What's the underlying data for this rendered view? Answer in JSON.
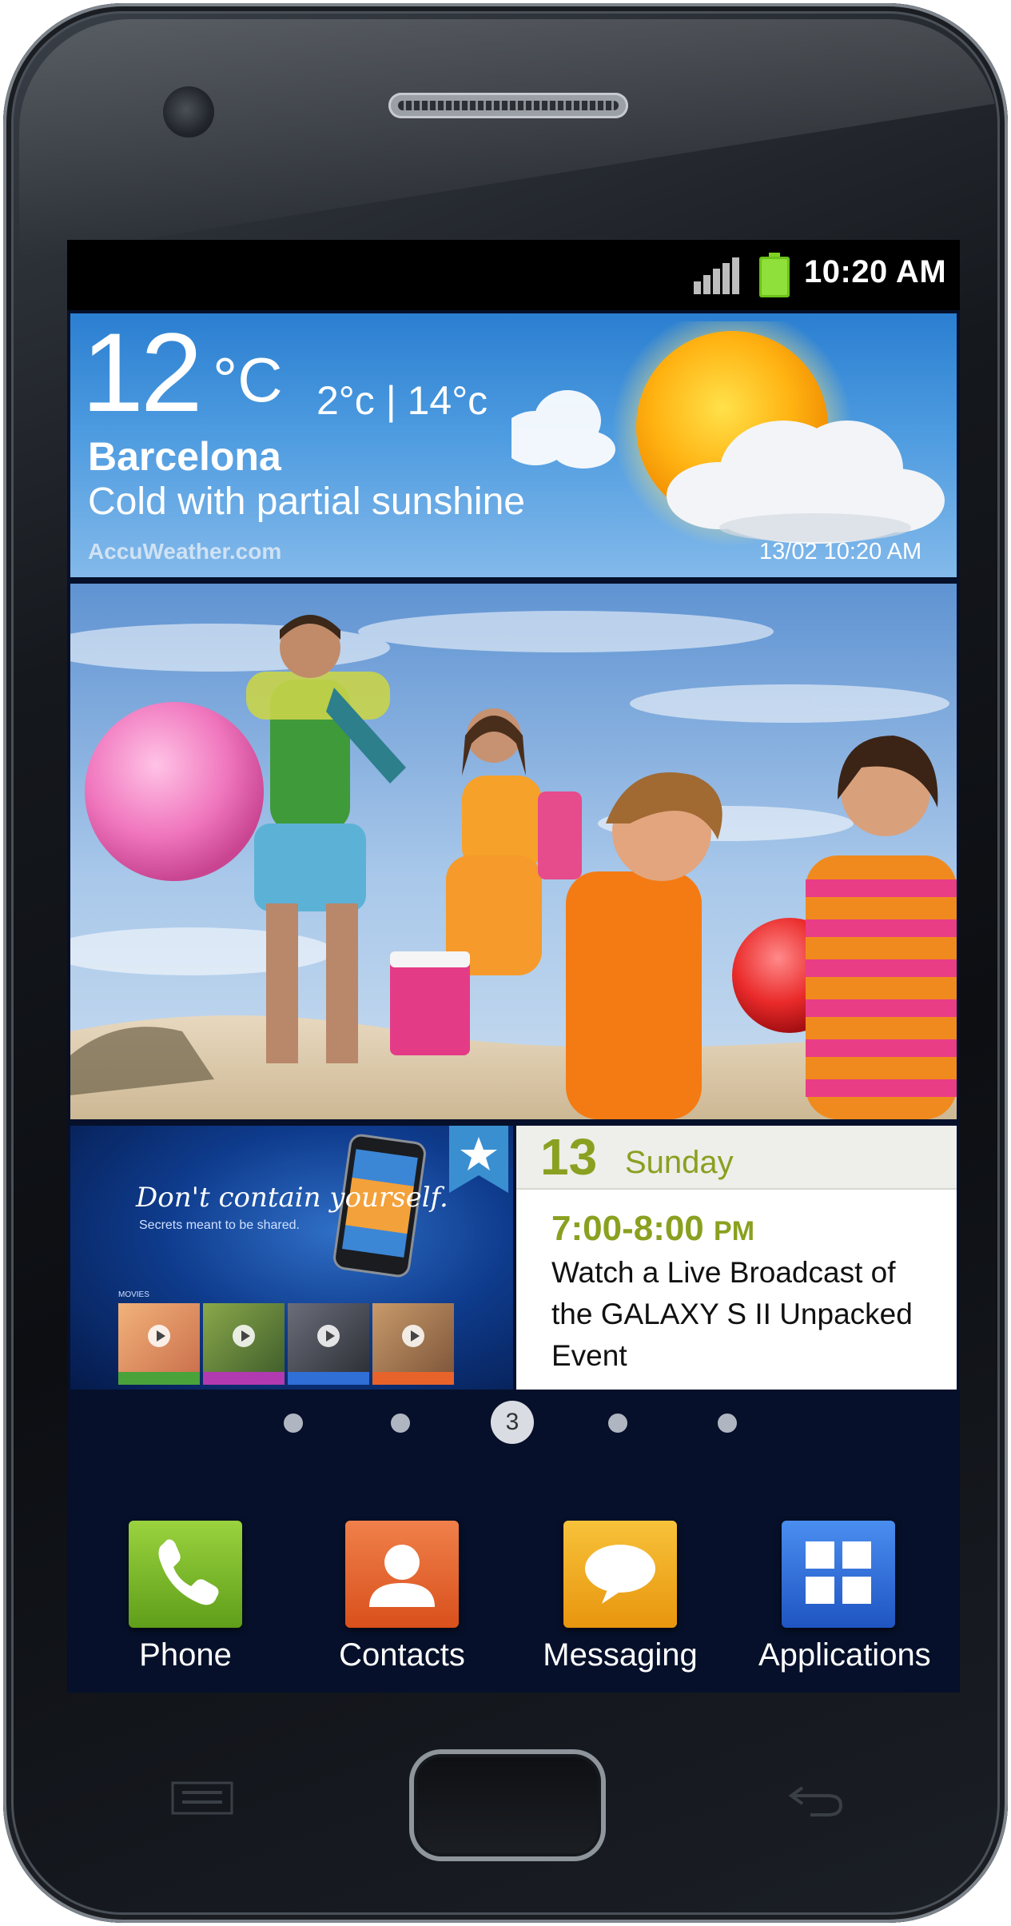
{
  "status_bar": {
    "time": "10:20 AM"
  },
  "weather": {
    "temperature": "12",
    "unit": "°C",
    "range": "2°c | 14°c",
    "city": "Barcelona",
    "description": "Cold with partial sunshine",
    "source": "AccuWeather.com",
    "updated": "13/02 10:20 AM"
  },
  "promo": {
    "tagline": "Don't contain yourself.",
    "subline": "Secrets meant to be shared.",
    "section": "MOVIES"
  },
  "calendar": {
    "day_number": "13",
    "weekday": "Sunday",
    "time": "7:00-8:00",
    "ampm": "PM",
    "event_title": "Watch a Live Broadcast of the GALAXY S II Unpacked Event"
  },
  "page_indicator": {
    "current_page": "3",
    "total_pages": 5
  },
  "dock": {
    "items": [
      {
        "label": "Phone",
        "icon": "phone-icon",
        "color": "#7cbb24"
      },
      {
        "label": "Contacts",
        "icon": "contacts-icon",
        "color": "#e8632a"
      },
      {
        "label": "Messaging",
        "icon": "messaging-icon",
        "color": "#f2a81c"
      },
      {
        "label": "Applications",
        "icon": "applications-icon",
        "color": "#2f6fd6"
      }
    ]
  },
  "colors": {
    "accent_green": "#8aa020",
    "weather_blue": "#2b7fd1"
  }
}
